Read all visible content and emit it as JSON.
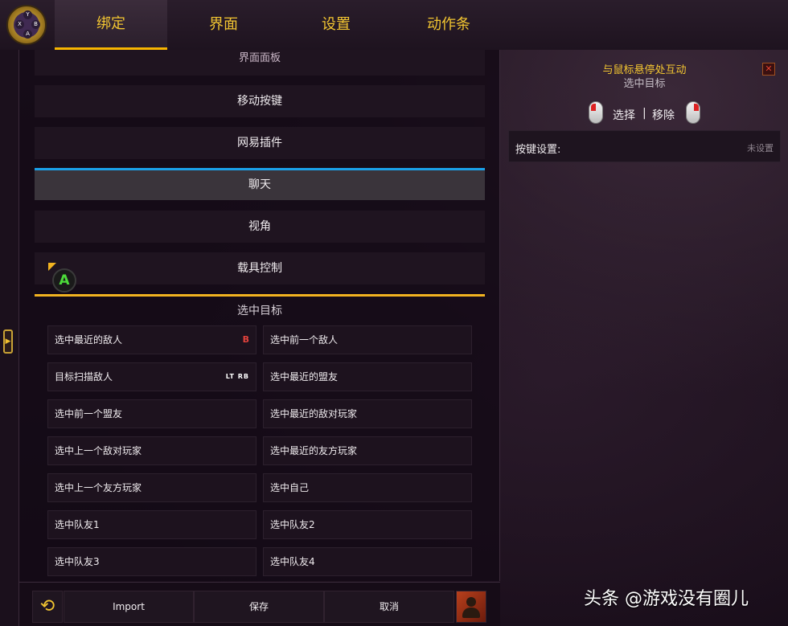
{
  "tabs": [
    "绑定",
    "界面",
    "设置",
    "动作条"
  ],
  "categories": {
    "partial": "界面面板",
    "items": [
      "移动按键",
      "网易插件",
      "聊天",
      "视角",
      "载具控制"
    ],
    "selected_index": 2
  },
  "section_title": "选中目标",
  "a_badge": "A",
  "bindings": [
    {
      "label": "选中最近的敌人",
      "key": "B"
    },
    {
      "label": "选中前一个敌人",
      "key": ""
    },
    {
      "label": "目标扫描敌人",
      "key": "LT RB"
    },
    {
      "label": "选中最近的盟友",
      "key": ""
    },
    {
      "label": "选中前一个盟友",
      "key": ""
    },
    {
      "label": "选中最近的敌对玩家",
      "key": ""
    },
    {
      "label": "选中上一个敌对玩家",
      "key": ""
    },
    {
      "label": "选中最近的友方玩家",
      "key": ""
    },
    {
      "label": "选中上一个友方玩家",
      "key": ""
    },
    {
      "label": "选中自己",
      "key": ""
    },
    {
      "label": "选中队友1",
      "key": ""
    },
    {
      "label": "选中队友2",
      "key": ""
    },
    {
      "label": "选中队友3",
      "key": ""
    },
    {
      "label": "选中队友4",
      "key": ""
    }
  ],
  "bottom": {
    "import_label": "Import",
    "save_label": "保存",
    "cancel_label": "取消"
  },
  "right_panel": {
    "title": "与鼠标悬停处互动",
    "subtitle": "选中目标",
    "select_label": "选择",
    "separator": "|",
    "remove_label": "移除",
    "keyset_label": "按键设置:",
    "keyset_value": "未设置"
  },
  "watermark": "头条 @游戏没有圈儿",
  "colors": {
    "accent_gold": "#f2c531",
    "selection_blue": "#1aa0e8",
    "key_b_red": "#e2423c",
    "a_button_green": "#4cdb3a"
  },
  "icons": [
    "controller-logo-icon",
    "side-handle-arrow-icon",
    "undo-icon",
    "profile-icon",
    "close-icon",
    "mouse-left-icon",
    "mouse-right-icon"
  ]
}
